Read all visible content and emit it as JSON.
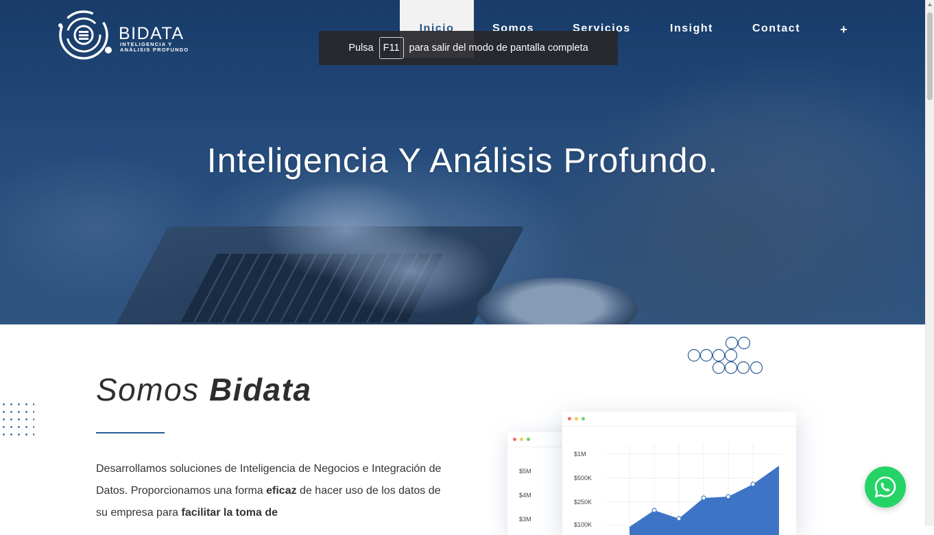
{
  "logo": {
    "brand": "BIDATA",
    "tagline_1": "INTELIGENCIA Y",
    "tagline_2": "ANÁLISIS PROFUNDO"
  },
  "nav": {
    "items": [
      {
        "label": "Inicio",
        "active": true
      },
      {
        "label": "Somos"
      },
      {
        "label": "Servicios"
      },
      {
        "label": "Insight"
      },
      {
        "label": "Contact"
      },
      {
        "label": "+"
      }
    ]
  },
  "fullscreen_toast": {
    "prefix": "Pulsa",
    "key": "F11",
    "suffix": "para salir del modo de pantalla completa"
  },
  "hero": {
    "title": "Inteligencia Y Análisis Profundo."
  },
  "about": {
    "title_light": "Somos",
    "title_bold": "Bidata",
    "text_1": "Desarrollamos soluciones de Inteligencia de Negocios e Integración de Datos. Proporcionamos una forma",
    "text_bold_1": "eficaz",
    "text_2": "de hacer uso de los datos de su empresa para",
    "text_bold_2": "facilitar la toma de"
  },
  "dashboard": {
    "back_ticks": [
      "$5M",
      "$4M",
      "$3M"
    ],
    "front_ticks": [
      "$1M",
      "$500K",
      "$250K",
      "$100K"
    ],
    "accent": "#3e74c6",
    "window_dots": [
      "#f26b6b",
      "#f2c94c",
      "#6fcf6f"
    ]
  },
  "colors": {
    "brand_blue": "#2a5585",
    "whatsapp": "#25d366"
  },
  "icons": {
    "logo": "bidata-logo-icon",
    "whatsapp": "whatsapp-icon"
  }
}
